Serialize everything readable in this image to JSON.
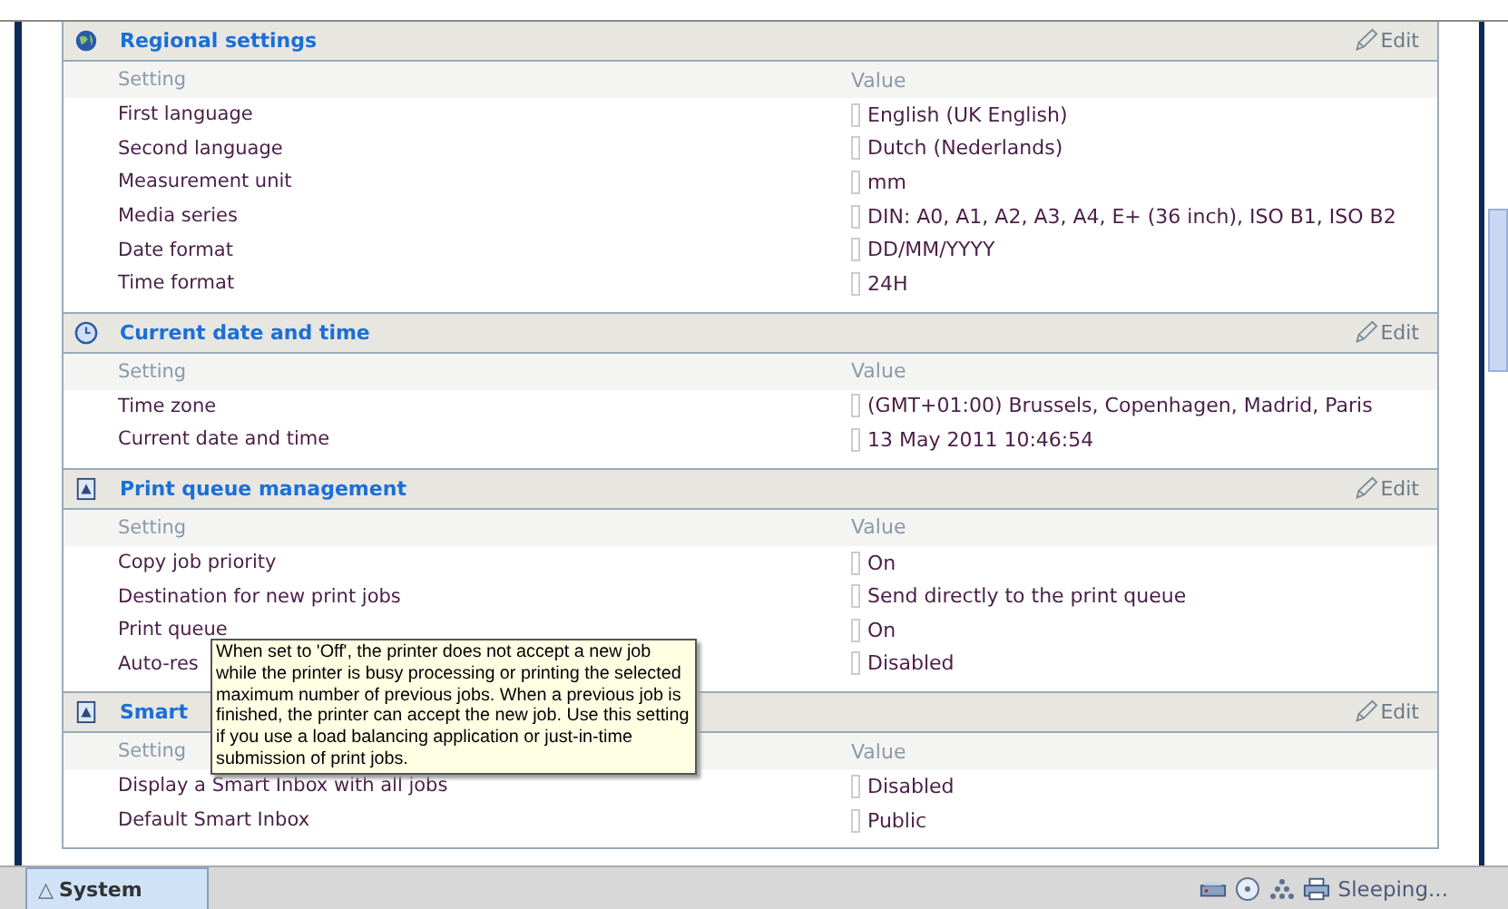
{
  "sections": [
    {
      "kind": "globe",
      "title": "Regional settings",
      "edit": "Edit",
      "columns": [
        "Setting",
        "Value"
      ],
      "rows": [
        {
          "setting": "First language",
          "value": "English (UK English)"
        },
        {
          "setting": "Second language",
          "value": "Dutch (Nederlands)"
        },
        {
          "setting": "Measurement unit",
          "value": "mm"
        },
        {
          "setting": "Media series",
          "value": "DIN: A0, A1, A2, A3, A4, E+ (36 inch), ISO B1, ISO B2"
        },
        {
          "setting": "Date format",
          "value": "DD/MM/YYYY"
        },
        {
          "setting": "Time format",
          "value": "24H"
        }
      ]
    },
    {
      "kind": "clock",
      "title": "Current date and time",
      "edit": "Edit",
      "columns": [
        "Setting",
        "Value"
      ],
      "rows": [
        {
          "setting": "Time zone",
          "value": "(GMT+01:00) Brussels, Copenhagen, Madrid, Paris"
        },
        {
          "setting": "Current date and time",
          "value": "13 May 2011 10:46:54"
        }
      ]
    },
    {
      "kind": "document",
      "title": "Print queue management",
      "edit": "Edit",
      "columns": [
        "Setting",
        "Value"
      ],
      "rows": [
        {
          "setting": "Copy job priority",
          "value": "On"
        },
        {
          "setting": "Destination for new print jobs",
          "value": "Send directly to the print queue"
        },
        {
          "setting": "Print queue",
          "value": "On"
        },
        {
          "setting": "Auto-res",
          "value": "Disabled"
        }
      ]
    },
    {
      "kind": "document",
      "title": "Smart",
      "edit": "Edit",
      "columns": [
        "Setting",
        "Value"
      ],
      "rows": [
        {
          "setting": "Display a Smart Inbox with all jobs",
          "value": "Disabled"
        },
        {
          "setting": "Default Smart Inbox",
          "value": "Public"
        }
      ]
    }
  ],
  "tooltip": "When set to 'Off', the printer does not accept a new job while the printer is busy processing or printing the selected maximum number of previous jobs. When a previous job is finished, the printer can accept the new job. Use this setting if you use a load balancing application or just-in-time submission of print jobs.",
  "status_bar": {
    "tab_icon": "△",
    "tab": "System",
    "status": "Sleeping..."
  }
}
